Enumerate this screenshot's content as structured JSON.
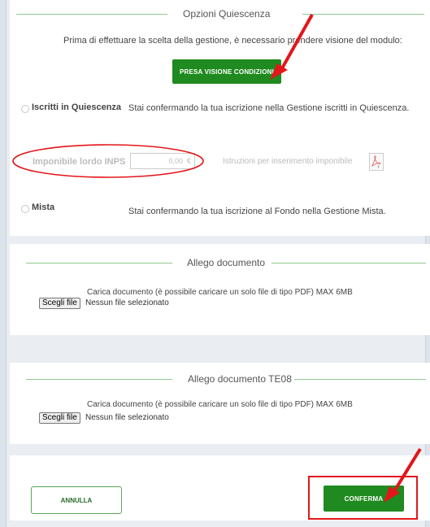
{
  "options_section": {
    "legend": "Opzioni Quiescenza",
    "notice": "Prima di effettuare la scelta della gestione, è necessario prendere visione del modulo:",
    "conditions_button": "PRESA VISIONE CONDIZIONI",
    "option_quiescenza": {
      "label": "Iscritti in Quiescenza",
      "description": "Stai confermando la tua iscrizione nella Gestione iscritti in Quiescenza."
    },
    "imponibile": {
      "label": "Imponibile lordo INPS",
      "value": "0,00",
      "currency": "€",
      "instructions": "Istruzioni per inserimento imponibile"
    },
    "option_mista": {
      "label": "Mista",
      "description": "Stai confermando la tua iscrizione al Fondo nella Gestione Mista."
    }
  },
  "allego_documento": {
    "legend": "Allego documento",
    "upload_text": "Carica documento (è possibile caricare un solo file di tipo PDF) MAX 6MB",
    "file_button": "Scegli file",
    "file_status": "Nessun file selezionato"
  },
  "allego_documento_te08": {
    "legend": "Allego documento TE08",
    "upload_text": "Carica documento (è possibile caricare un solo file di tipo PDF) MAX 6MB",
    "file_button": "Scegli file",
    "file_status": "Nessun file selezionato"
  },
  "footer": {
    "cancel_label": "ANNULLA",
    "confirm_label": "CONFERMA"
  },
  "colors": {
    "brand_green": "#1f8a1f",
    "legend_line": "#8fc98f",
    "annotation_red": "#e3161b"
  }
}
